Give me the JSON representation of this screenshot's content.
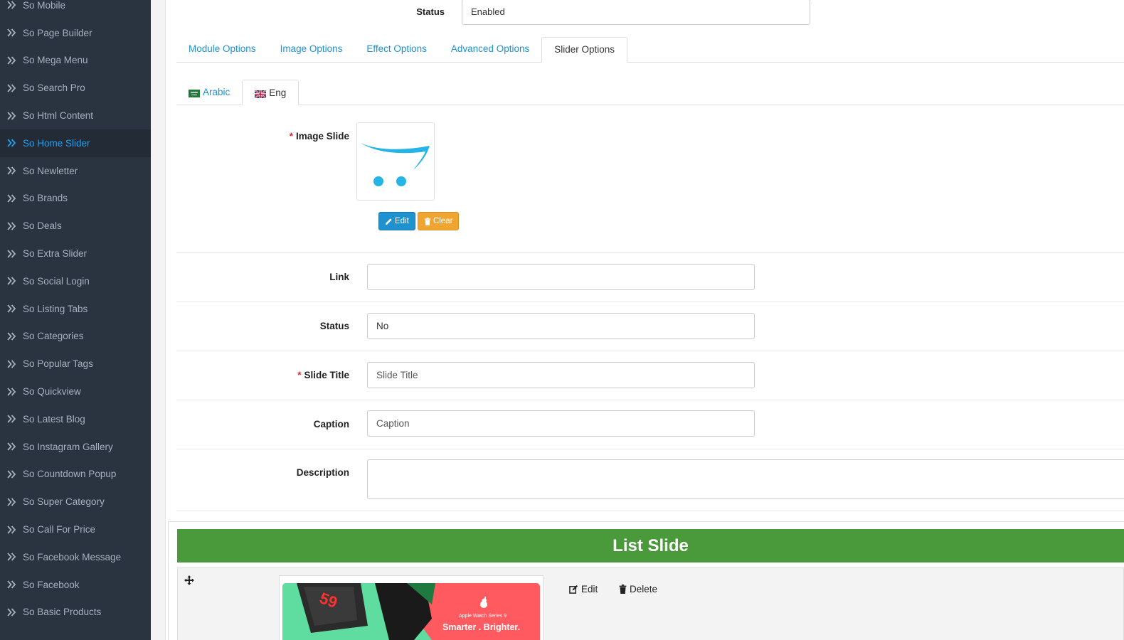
{
  "sidebar": {
    "items": [
      {
        "label": "So Mobile",
        "active": false
      },
      {
        "label": "So Page Builder",
        "active": false
      },
      {
        "label": "So Mega Menu",
        "active": false
      },
      {
        "label": "So Search Pro",
        "active": false
      },
      {
        "label": "So Html Content",
        "active": false
      },
      {
        "label": "So Home Slider",
        "active": true
      },
      {
        "label": "So Newletter",
        "active": false
      },
      {
        "label": "So Brands",
        "active": false
      },
      {
        "label": "So Deals",
        "active": false
      },
      {
        "label": "So Extra Slider",
        "active": false
      },
      {
        "label": "So Social Login",
        "active": false
      },
      {
        "label": "So Listing Tabs",
        "active": false
      },
      {
        "label": "So Categories",
        "active": false
      },
      {
        "label": "So Popular Tags",
        "active": false
      },
      {
        "label": "So Quickview",
        "active": false
      },
      {
        "label": "So Latest Blog",
        "active": false
      },
      {
        "label": "So Instagram Gallery",
        "active": false
      },
      {
        "label": "So Countdown Popup",
        "active": false
      },
      {
        "label": "So Super Category",
        "active": false
      },
      {
        "label": "So Call For Price",
        "active": false
      },
      {
        "label": "So Facebook Message",
        "active": false
      },
      {
        "label": "So Facebook",
        "active": false
      },
      {
        "label": "So Basic Products",
        "active": false
      }
    ]
  },
  "top_status": {
    "label": "Status",
    "value": "Enabled"
  },
  "tabs": [
    {
      "label": "Module Options",
      "active": false
    },
    {
      "label": "Image Options",
      "active": false
    },
    {
      "label": "Effect Options",
      "active": false
    },
    {
      "label": "Advanced Options",
      "active": false
    },
    {
      "label": "Slider Options",
      "active": true
    }
  ],
  "lang_tabs": [
    {
      "label": "Arabic",
      "active": false
    },
    {
      "label": "Eng",
      "active": true
    }
  ],
  "form": {
    "image_slide_label": "Image Slide",
    "edit_label": "Edit",
    "clear_label": "Clear",
    "link_label": "Link",
    "link_value": "",
    "status_label": "Status",
    "status_value": "No",
    "slide_title_label": "Slide Title",
    "slide_title_placeholder": "Slide Title",
    "caption_label": "Caption",
    "caption_placeholder": "Caption",
    "description_label": "Description"
  },
  "list": {
    "header": "List Slide",
    "edit_label": "Edit",
    "delete_label": "Delete",
    "banner_small": "Apple Watch Series 9",
    "banner_big": "Smarter . Brighter."
  },
  "colors": {
    "sidebar_bg": "#2a3340",
    "accent": "#1e91cf",
    "active_sidebar": "#1e9ff2",
    "list_header": "#4a9a3c",
    "clear_button": "#f0a532",
    "required": "#e3272d"
  }
}
